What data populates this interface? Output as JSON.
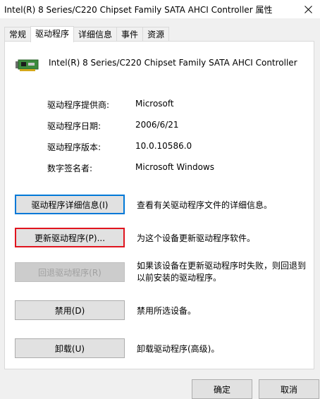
{
  "window": {
    "title": "Intel(R) 8 Series/C220 Chipset Family SATA AHCI Controller  属性"
  },
  "tabs": [
    {
      "label": "常规"
    },
    {
      "label": "驱动程序"
    },
    {
      "label": "详细信息"
    },
    {
      "label": "事件"
    },
    {
      "label": "资源"
    }
  ],
  "device": {
    "name": "Intel(R) 8 Series/C220 Chipset Family SATA AHCI Controller",
    "icon": "controller-card-icon"
  },
  "properties": [
    {
      "label": "驱动程序提供商:",
      "value": "Microsoft"
    },
    {
      "label": "驱动程序日期:",
      "value": "2006/6/21"
    },
    {
      "label": "驱动程序版本:",
      "value": "10.0.10586.0"
    },
    {
      "label": "数字签名者:",
      "value": "Microsoft Windows"
    }
  ],
  "actions": [
    {
      "label": "驱动程序详细信息(I)",
      "description": "查看有关驱动程序文件的详细信息。"
    },
    {
      "label": "更新驱动程序(P)...",
      "description": "为这个设备更新驱动程序软件。"
    },
    {
      "label": "回退驱动程序(R)",
      "description_line1": "如果该设备在更新驱动程序时失败，则回退到",
      "description_line2": "以前安装的驱动程序。"
    },
    {
      "label": "禁用(D)",
      "description": "禁用所选设备。"
    },
    {
      "label": "卸载(U)",
      "description": "卸载驱动程序(高级)。"
    }
  ],
  "footer": {
    "ok_label": "确定",
    "cancel_label": "取消"
  },
  "colors": {
    "focus_border": "#0078d7",
    "highlight_border": "#e0141e"
  }
}
